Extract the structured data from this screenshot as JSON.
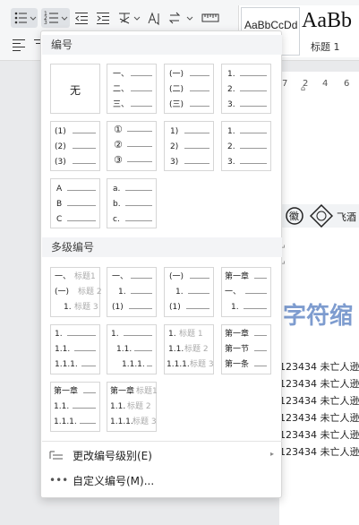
{
  "style_gallery": {
    "sample1": "AaBbCcDd",
    "sample2": "AaBb",
    "heading1_label": "标题 1"
  },
  "ruler": {
    "ticks": [
      "7",
      "2",
      "4",
      "6"
    ]
  },
  "menu": {
    "section_numbering": "编号",
    "section_multilevel": "多级编号",
    "none_label": "无",
    "change_level": "更改编号级别(E)",
    "custom": "自定义编号(M)..."
  },
  "tiles": {
    "t1": [
      "一、",
      "二、",
      "三、"
    ],
    "t2": [
      "(一)",
      "(二)",
      "(三)"
    ],
    "t3": [
      "1.",
      "2.",
      "3."
    ],
    "t4": [
      "(1)",
      "(2)",
      "(3)"
    ],
    "t5": [
      "①",
      "②",
      "③"
    ],
    "t6": [
      "1)",
      "2)",
      "3)"
    ],
    "t7": [
      "1.",
      "2.",
      "3."
    ],
    "t8": [
      "A",
      "B",
      "C"
    ],
    "t9": [
      "a.",
      "b.",
      "c."
    ],
    "m1": [
      [
        "一、",
        "标题1"
      ],
      [
        "(一)",
        "标题 2"
      ],
      [
        "1.",
        "标题 3"
      ]
    ],
    "m2": [
      "一、",
      "1.",
      "(1)"
    ],
    "m3": [
      "(一)",
      "1.",
      "(1)"
    ],
    "m4": [
      "第一章",
      "一、",
      "1."
    ],
    "m5": [
      "1.",
      "1.1.",
      "1.1.1."
    ],
    "m6": [
      "1.",
      "1.1.",
      "1.1.1."
    ],
    "m7": [
      [
        "1.",
        "标题 1"
      ],
      [
        "1.1.",
        "标题 2"
      ],
      [
        "1.1.1.",
        "标题 3"
      ]
    ],
    "m8": [
      "第一章",
      "第一节",
      "第一条"
    ],
    "m9": [
      "第一章",
      "1.1.",
      "1.1.1."
    ],
    "m10": [
      [
        "第一章",
        "标题1"
      ],
      [
        "1.1.",
        "标题 2"
      ],
      [
        "1.1.1.",
        "标题 3"
      ]
    ]
  },
  "document": {
    "symbol_label": "飞酒",
    "heading": "字符缩",
    "para_marks": [
      "↵",
      "↵"
    ],
    "lines": [
      "123434 未亡人逊",
      "123434 未亡人逊",
      "123434 未亡人逊",
      "123434 未亡人逊",
      "123434 未亡人逊",
      "123434 未亡人逊"
    ]
  }
}
